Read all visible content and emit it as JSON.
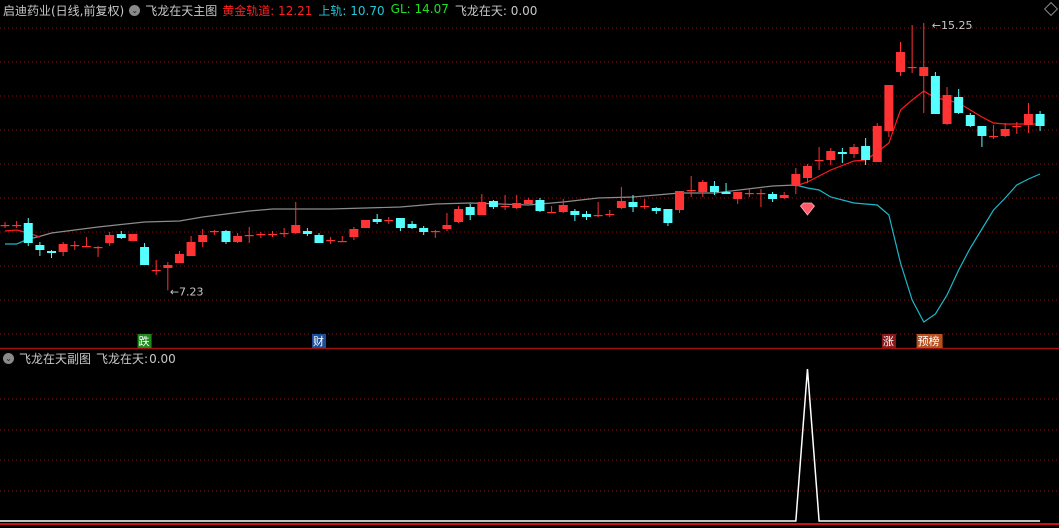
{
  "main_header": {
    "stock": "启迪药业(日线,前复权)",
    "indicator": "飞龙在天主图",
    "items": [
      {
        "label": "黄金轨道:",
        "value": "12.21",
        "color": "#ff2020"
      },
      {
        "label": "上轨:",
        "value": "10.70",
        "color": "#20c8d8"
      },
      {
        "label": "GL:",
        "value": "14.07",
        "color": "#20e020"
      },
      {
        "label": "飞龙在天:",
        "value": "0.00",
        "color": "#c8c8c8"
      }
    ]
  },
  "sub_header": {
    "indicator": "飞龙在天副图",
    "label": "飞龙在天:",
    "value": "0.00"
  },
  "colors": {
    "up": "#ff3333",
    "down": "#55ffff",
    "ma_gray": "#8c8c8c",
    "ma_red": "#ff1a1a",
    "line_cyan": "#1ab8c8",
    "grid": "#8b1010",
    "sub_line": "#ffffff"
  },
  "chart_data": {
    "type": "candlestick",
    "price_extremes": {
      "high_label": "15.25",
      "low_label": "7.23",
      "high_index": 79,
      "low_index": 14
    },
    "ohlc": [
      [
        9.19,
        9.28,
        9.1,
        9.19
      ],
      [
        9.19,
        9.31,
        9.1,
        9.19
      ],
      [
        9.25,
        9.4,
        8.56,
        8.65
      ],
      [
        8.59,
        8.68,
        8.26,
        8.44
      ],
      [
        8.41,
        8.44,
        8.2,
        8.35
      ],
      [
        8.38,
        8.68,
        8.26,
        8.62
      ],
      [
        8.59,
        8.71,
        8.44,
        8.59
      ],
      [
        8.56,
        8.83,
        8.53,
        8.56
      ],
      [
        8.53,
        8.56,
        8.23,
        8.53
      ],
      [
        8.65,
        8.98,
        8.56,
        8.89
      ],
      [
        8.92,
        9.01,
        8.77,
        8.8
      ],
      [
        8.71,
        8.92,
        8.71,
        8.92
      ],
      [
        8.53,
        8.65,
        7.99,
        7.99
      ],
      [
        7.84,
        8.14,
        7.69,
        7.84
      ],
      [
        7.9,
        8.08,
        7.23,
        7.99
      ],
      [
        8.05,
        8.41,
        8.05,
        8.32
      ],
      [
        8.26,
        8.86,
        8.26,
        8.68
      ],
      [
        8.68,
        9.07,
        8.53,
        8.89
      ],
      [
        9.01,
        9.04,
        8.89,
        9.01
      ],
      [
        9.01,
        9.04,
        8.62,
        8.68
      ],
      [
        8.68,
        8.95,
        8.65,
        8.86
      ],
      [
        8.89,
        9.13,
        8.65,
        8.89
      ],
      [
        8.92,
        8.98,
        8.8,
        8.92
      ],
      [
        8.92,
        9.01,
        8.83,
        8.92
      ],
      [
        8.95,
        9.1,
        8.83,
        8.95
      ],
      [
        8.95,
        9.88,
        8.92,
        9.19
      ],
      [
        9.01,
        9.1,
        8.86,
        8.92
      ],
      [
        8.89,
        8.95,
        8.65,
        8.65
      ],
      [
        8.74,
        8.83,
        8.62,
        8.74
      ],
      [
        8.71,
        8.86,
        8.68,
        8.71
      ],
      [
        8.83,
        9.13,
        8.74,
        9.07
      ],
      [
        9.1,
        9.34,
        9.1,
        9.34
      ],
      [
        9.37,
        9.52,
        9.22,
        9.28
      ],
      [
        9.34,
        9.43,
        9.22,
        9.34
      ],
      [
        9.4,
        9.4,
        9.01,
        9.1
      ],
      [
        9.22,
        9.31,
        9.07,
        9.1
      ],
      [
        9.1,
        9.16,
        8.89,
        8.98
      ],
      [
        9.01,
        9.04,
        8.8,
        9.01
      ],
      [
        9.07,
        9.55,
        9.01,
        9.19
      ],
      [
        9.28,
        9.76,
        9.25,
        9.67
      ],
      [
        9.73,
        9.82,
        9.34,
        9.49
      ],
      [
        9.49,
        10.12,
        9.49,
        9.88
      ],
      [
        9.91,
        9.94,
        9.67,
        9.73
      ],
      [
        9.76,
        10.09,
        9.64,
        9.76
      ],
      [
        9.7,
        10.09,
        9.67,
        9.85
      ],
      [
        9.82,
        10.0,
        9.82,
        9.94
      ],
      [
        9.94,
        10.0,
        9.58,
        9.61
      ],
      [
        9.58,
        9.76,
        9.55,
        9.58
      ],
      [
        9.58,
        9.97,
        9.55,
        9.79
      ],
      [
        9.61,
        9.67,
        9.31,
        9.49
      ],
      [
        9.52,
        9.61,
        9.34,
        9.43
      ],
      [
        9.49,
        9.88,
        9.43,
        9.49
      ],
      [
        9.52,
        9.64,
        9.43,
        9.52
      ],
      [
        9.7,
        10.33,
        9.67,
        9.91
      ],
      [
        9.88,
        10.09,
        9.58,
        9.73
      ],
      [
        9.76,
        9.97,
        9.67,
        9.76
      ],
      [
        9.7,
        9.73,
        9.52,
        9.61
      ],
      [
        9.67,
        9.67,
        9.16,
        9.25
      ],
      [
        9.64,
        10.21,
        9.55,
        10.21
      ],
      [
        10.24,
        10.66,
        10.03,
        10.24
      ],
      [
        10.18,
        10.54,
        10.03,
        10.48
      ],
      [
        10.36,
        10.51,
        10.09,
        10.18
      ],
      [
        10.18,
        10.45,
        10.12,
        10.12
      ],
      [
        9.97,
        10.18,
        9.82,
        10.18
      ],
      [
        10.15,
        10.3,
        10.03,
        10.15
      ],
      [
        10.15,
        10.27,
        9.73,
        10.15
      ],
      [
        10.12,
        10.18,
        9.88,
        9.97
      ],
      [
        10.0,
        10.18,
        9.97,
        10.09
      ],
      [
        10.36,
        10.9,
        10.12,
        10.72
      ],
      [
        10.6,
        11.02,
        10.45,
        10.96
      ],
      [
        11.14,
        11.53,
        10.84,
        11.14
      ],
      [
        11.14,
        11.5,
        10.99,
        11.41
      ],
      [
        11.38,
        11.5,
        11.05,
        11.32
      ],
      [
        11.32,
        11.62,
        11.2,
        11.53
      ],
      [
        11.56,
        11.8,
        10.99,
        11.14
      ],
      [
        11.08,
        12.25,
        11.08,
        12.16
      ],
      [
        12.01,
        13.39,
        11.83,
        13.39
      ],
      [
        13.78,
        14.68,
        13.66,
        14.38
      ],
      [
        13.93,
        15.19,
        13.75,
        13.93
      ],
      [
        13.66,
        15.25,
        12.55,
        13.93
      ],
      [
        13.66,
        13.78,
        12.52,
        12.52
      ],
      [
        12.22,
        13.33,
        12.19,
        13.09
      ],
      [
        13.03,
        13.27,
        12.52,
        12.55
      ],
      [
        12.49,
        12.55,
        12.13,
        12.16
      ],
      [
        12.16,
        12.16,
        11.53,
        11.86
      ],
      [
        11.86,
        12.19,
        11.77,
        11.86
      ],
      [
        11.86,
        12.25,
        11.83,
        12.07
      ],
      [
        12.16,
        12.28,
        11.92,
        12.16
      ],
      [
        12.19,
        12.85,
        11.95,
        12.52
      ],
      [
        12.52,
        12.61,
        12.01,
        12.16
      ]
    ],
    "lines": [
      {
        "name": "gray-ma",
        "color_key": "ma_gray",
        "points": [
          [
            2.8,
            8.83
          ],
          [
            4,
            8.95
          ],
          [
            8,
            9.13
          ],
          [
            12,
            9.28
          ],
          [
            15,
            9.31
          ],
          [
            17,
            9.43
          ],
          [
            21,
            9.61
          ],
          [
            23,
            9.67
          ],
          [
            28,
            9.67
          ],
          [
            31,
            9.7
          ],
          [
            34,
            9.73
          ],
          [
            37,
            9.82
          ],
          [
            40,
            9.85
          ],
          [
            45,
            9.79
          ],
          [
            48,
            9.88
          ],
          [
            51,
            10.0
          ],
          [
            54,
            10.03
          ],
          [
            56,
            10.09
          ],
          [
            58,
            10.15
          ],
          [
            61,
            10.15
          ],
          [
            66,
            10.36
          ],
          [
            68,
            10.39
          ]
        ]
      },
      {
        "name": "cyan-line-head",
        "color_key": "line_cyan",
        "points": [
          [
            0,
            8.62
          ],
          [
            1,
            8.62
          ],
          [
            2,
            8.77
          ],
          [
            2.8,
            8.83
          ]
        ]
      },
      {
        "name": "cyan-line-tail",
        "color_key": "line_cyan",
        "points": [
          [
            68,
            10.39
          ],
          [
            69,
            10.3
          ],
          [
            70,
            10.24
          ],
          [
            71,
            10.03
          ],
          [
            73,
            9.85
          ],
          [
            74,
            9.82
          ],
          [
            75,
            9.79
          ],
          [
            76,
            9.49
          ],
          [
            77,
            8.05
          ],
          [
            78,
            6.94
          ],
          [
            79,
            6.28
          ],
          [
            80,
            6.52
          ],
          [
            81,
            7.09
          ],
          [
            82,
            7.84
          ],
          [
            83,
            8.5
          ],
          [
            84,
            9.07
          ],
          [
            85,
            9.64
          ],
          [
            86,
            10.0
          ],
          [
            87,
            10.39
          ],
          [
            88,
            10.57
          ],
          [
            89,
            10.72
          ]
        ]
      },
      {
        "name": "red-ma-head",
        "color_key": "ma_red",
        "points": [
          [
            0,
            9.01
          ],
          [
            1,
            9.04
          ],
          [
            2,
            8.95
          ],
          [
            3,
            8.83
          ]
        ]
      },
      {
        "name": "red-ma-tail",
        "color_key": "ma_red",
        "points": [
          [
            68,
            10.36
          ],
          [
            69,
            10.48
          ],
          [
            71,
            10.84
          ],
          [
            73,
            11.11
          ],
          [
            74,
            11.14
          ],
          [
            75,
            11.38
          ],
          [
            76,
            11.65
          ],
          [
            77,
            12.64
          ],
          [
            78,
            12.94
          ],
          [
            79,
            13.21
          ],
          [
            80,
            13.0
          ],
          [
            81,
            12.94
          ],
          [
            82,
            12.85
          ],
          [
            83,
            12.64
          ],
          [
            84,
            12.43
          ],
          [
            85,
            12.25
          ],
          [
            86,
            12.22
          ],
          [
            87,
            12.22
          ],
          [
            88,
            12.22
          ],
          [
            89,
            12.22
          ]
        ]
      }
    ],
    "signals": [
      {
        "index": 12,
        "text": "跌",
        "bg": "#1e8a1e"
      },
      {
        "index": 27,
        "text": "财",
        "bg": "#1a4f9a"
      },
      {
        "index": 76,
        "text": "涨",
        "bg": "#8a1a1a"
      },
      {
        "index": 79.5,
        "text": "预榜",
        "bg": "#b8501e"
      }
    ],
    "gem_index": 69,
    "sub_series": {
      "name": "飞龙在天",
      "values_nonzero": [
        [
          69,
          1
        ]
      ],
      "count": 90,
      "ylim": [
        0,
        1
      ]
    }
  }
}
